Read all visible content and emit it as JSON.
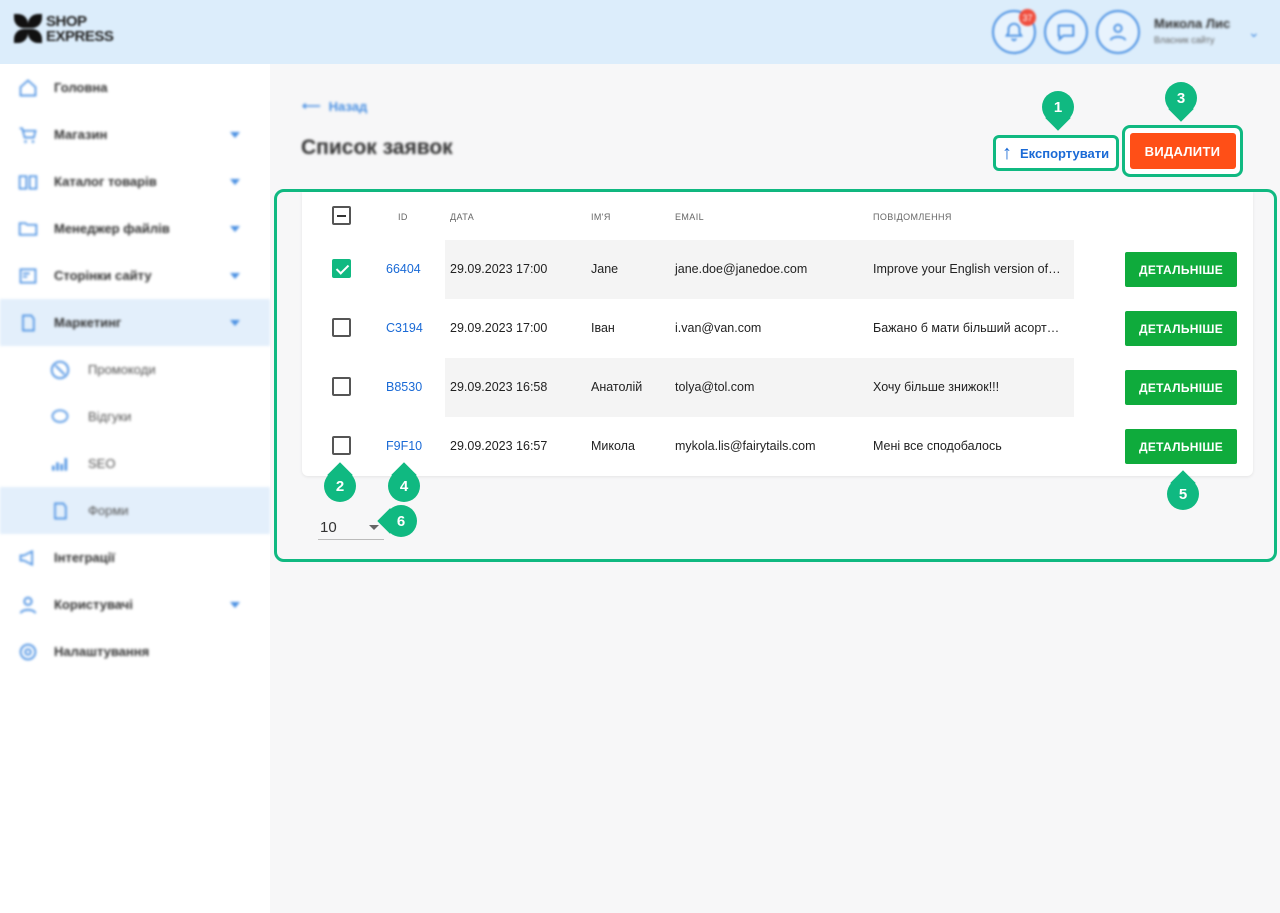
{
  "app": {
    "logo_line1": "SHOP",
    "logo_line2": "EXPRESS"
  },
  "topbar": {
    "notifications_count": "37",
    "user_name": "Микола Лис",
    "user_role": "Власник сайту"
  },
  "sidebar": {
    "items": [
      {
        "label": "Головна",
        "icon": "home-icon"
      },
      {
        "label": "Магазин",
        "icon": "cart-icon"
      },
      {
        "label": "Каталог товарів",
        "icon": "book-icon"
      },
      {
        "label": "Менеджер файлів",
        "icon": "folder-icon"
      },
      {
        "label": "Сторінки сайту",
        "icon": "page-icon"
      },
      {
        "label": "Маркетинг",
        "icon": "marketing-icon"
      },
      {
        "label": "Промокоди",
        "icon": "percent-icon"
      },
      {
        "label": "Відгуки",
        "icon": "chat-icon"
      },
      {
        "label": "SEO",
        "icon": "chart-icon"
      },
      {
        "label": "Форми",
        "icon": "form-icon"
      },
      {
        "label": "Інтеграції",
        "icon": "megaphone-icon"
      },
      {
        "label": "Користувачі",
        "icon": "users-icon"
      },
      {
        "label": "Налаштування",
        "icon": "settings-icon"
      }
    ]
  },
  "main": {
    "back_label": "Назад",
    "title": "Список заявок",
    "export_label": "Експортувати",
    "delete_label": "ВИДАЛИТИ"
  },
  "table": {
    "columns": {
      "id": "ID",
      "date": "ДАТА",
      "name": "ІМ'Я",
      "email": "EMAIL",
      "message": "ПОВІДОМЛЕННЯ"
    },
    "rows": [
      {
        "id": "66404",
        "date": "29.09.2023 17:00",
        "name": "Jane",
        "email": "jane.doe@janedoe.com",
        "message": "Improve your English version of site",
        "checked": true,
        "action": "ДЕТАЛЬНІШЕ"
      },
      {
        "id": "C3194",
        "date": "29.09.2023 17:00",
        "name": "Іван",
        "email": "i.van@van.com",
        "message": "Бажано б мати більший асортимент",
        "checked": false,
        "action": "ДЕТАЛЬНІШЕ"
      },
      {
        "id": "B8530",
        "date": "29.09.2023 16:58",
        "name": "Анатолій",
        "email": "tolya@tol.com",
        "message": "Хочу більше знижок!!!",
        "checked": false,
        "action": "ДЕТАЛЬНІШЕ"
      },
      {
        "id": "F9F10",
        "date": "29.09.2023 16:57",
        "name": "Микола",
        "email": "mykola.lis@fairytails.com",
        "message": "Мені все сподобалось",
        "checked": false,
        "action": "ДЕТАЛЬНІШЕ"
      }
    ]
  },
  "pagination": {
    "per_page": "10"
  },
  "markers": [
    "1",
    "2",
    "3",
    "4",
    "5",
    "6"
  ],
  "colors": {
    "accent_green": "#10b981",
    "delete_orange": "#ff4f17",
    "detail_green": "#0fab3c",
    "link_blue": "#1a6ad6",
    "topbar": "#dcedfb"
  }
}
